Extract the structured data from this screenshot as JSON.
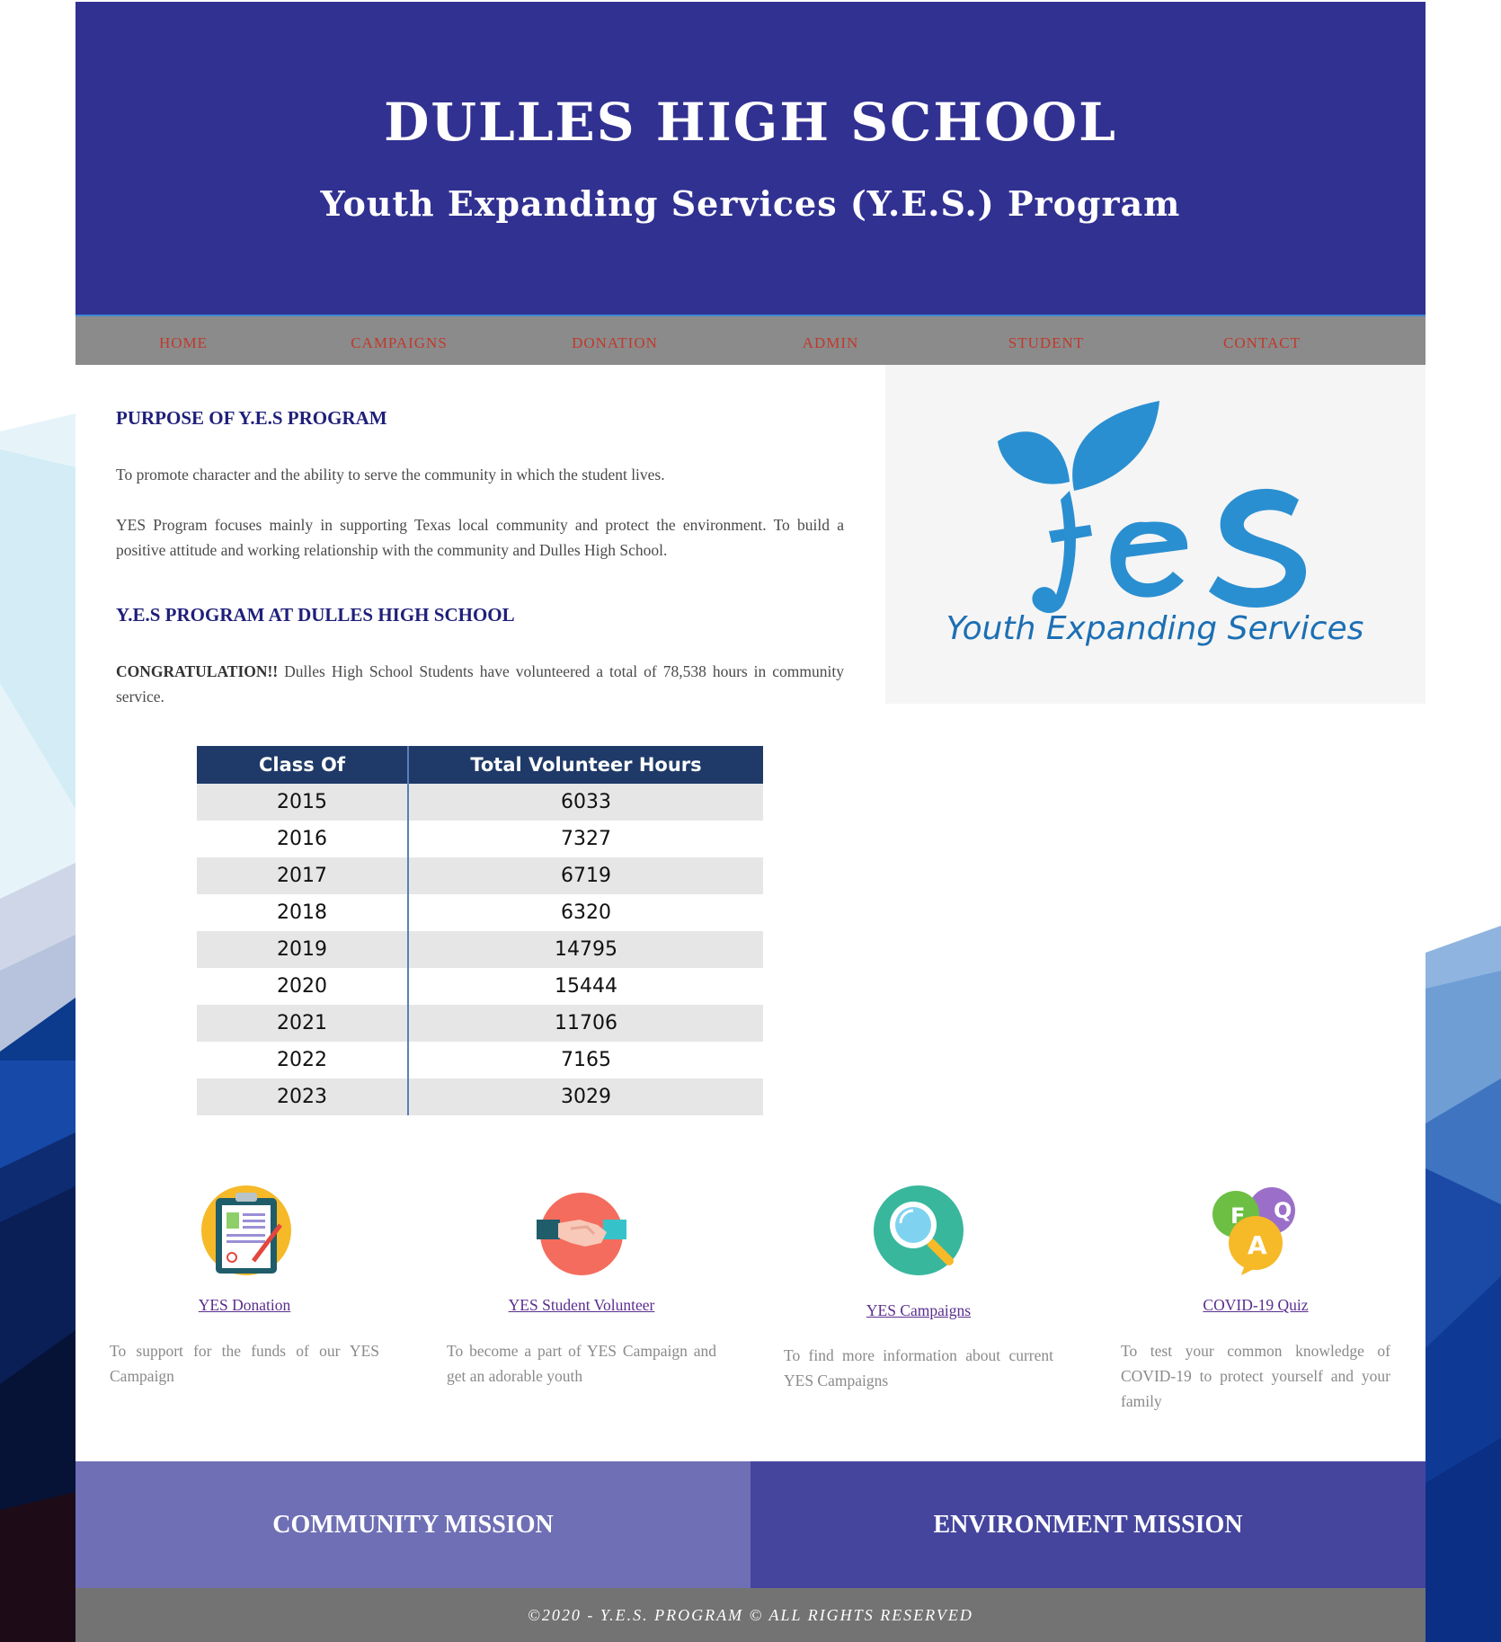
{
  "header": {
    "title": "DULLES HIGH SCHOOL",
    "subtitle": "Youth Expanding Services (Y.E.S.) Program"
  },
  "nav": {
    "items": [
      "HOME",
      "CAMPAIGNS",
      "DONATION",
      "ADMIN",
      "STUDENT",
      "CONTACT"
    ]
  },
  "purpose": {
    "heading": "PURPOSE OF Y.E.S PROGRAM",
    "p1": "To promote character and the ability to serve the community in which the student lives.",
    "p2": "YES Program focuses mainly in supporting Texas local community and protect the environment. To build a positive attitude and working relationship with the community and Dulles High School."
  },
  "program": {
    "heading": "Y.E.S PROGRAM AT DULLES HIGH SCHOOL",
    "congrats_bold": "CONGRATULATION!!",
    "congrats_text": " Dulles High School Students have volunteered a total of 78,538 hours in community service."
  },
  "logo": {
    "text": "Youth Expanding Services",
    "color": "#2a8fd1"
  },
  "table": {
    "headers": [
      "Class Of",
      "Total Volunteer Hours"
    ],
    "rows": [
      [
        "2015",
        "6033"
      ],
      [
        "2016",
        "7327"
      ],
      [
        "2017",
        "6719"
      ],
      [
        "2018",
        "6320"
      ],
      [
        "2019",
        "14795"
      ],
      [
        "2020",
        "15444"
      ],
      [
        "2021",
        "11706"
      ],
      [
        "2022",
        "7165"
      ],
      [
        "2023",
        "3029"
      ]
    ]
  },
  "features": [
    {
      "icon": "clipboard-icon",
      "link": "YES Donation",
      "desc": "To support for the funds of our YES Campaign"
    },
    {
      "icon": "handshake-icon",
      "link": "YES Student Volunteer",
      "desc": "To become a part of YES Campaign and get an adorable youth"
    },
    {
      "icon": "magnifier-icon",
      "link": "YES Campaigns",
      "desc": "To find more information about current YES Campaigns"
    },
    {
      "icon": "faq-icon",
      "link": "COVID-19 Quiz",
      "desc": "To test your common knowledge of COVID-19 to protect yourself and your family"
    }
  ],
  "missions": {
    "community": "COMMUNITY MISSION",
    "environment": "ENVIRONMENT MISSION",
    "community_color": "#6f6fb5",
    "environment_color": "#45459e"
  },
  "footer": {
    "text": "©2020 - Y.E.S. PROGRAM © ALL RIGHTS RESERVED"
  }
}
